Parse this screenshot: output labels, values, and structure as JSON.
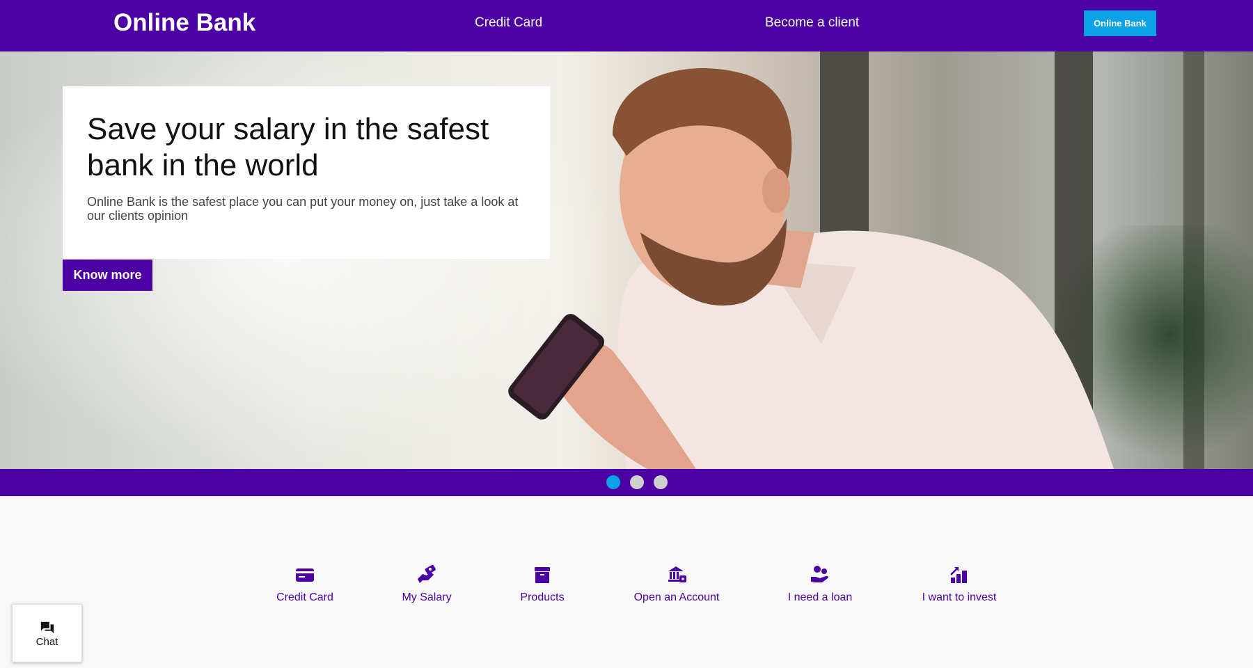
{
  "header": {
    "brand": "Online Bank",
    "nav": [
      {
        "label": "Credit Card"
      },
      {
        "label": "Become a client"
      }
    ],
    "cta_label": "Online Bank"
  },
  "hero": {
    "title": "Save your salary in the safest bank in the world",
    "description": "Online Bank is the safest place you can put your money on, just take a look at our clients opinion",
    "button_label": "Know more"
  },
  "carousel": {
    "slides": 3,
    "active_index": 0
  },
  "services": [
    {
      "label": "Credit Card",
      "icon": "credit-card-icon"
    },
    {
      "label": "My Salary",
      "icon": "salary-hand-icon"
    },
    {
      "label": "Products",
      "icon": "box-icon"
    },
    {
      "label": "Open an Account",
      "icon": "bank-icon"
    },
    {
      "label": "I need a loan",
      "icon": "loan-hand-icon"
    },
    {
      "label": "I want to invest",
      "icon": "chart-growth-icon"
    }
  ],
  "chat": {
    "label": "Chat",
    "icon": "chat-bubbles-icon"
  },
  "colors": {
    "primary": "#4b01a3",
    "accent": "#0aa1e6"
  }
}
